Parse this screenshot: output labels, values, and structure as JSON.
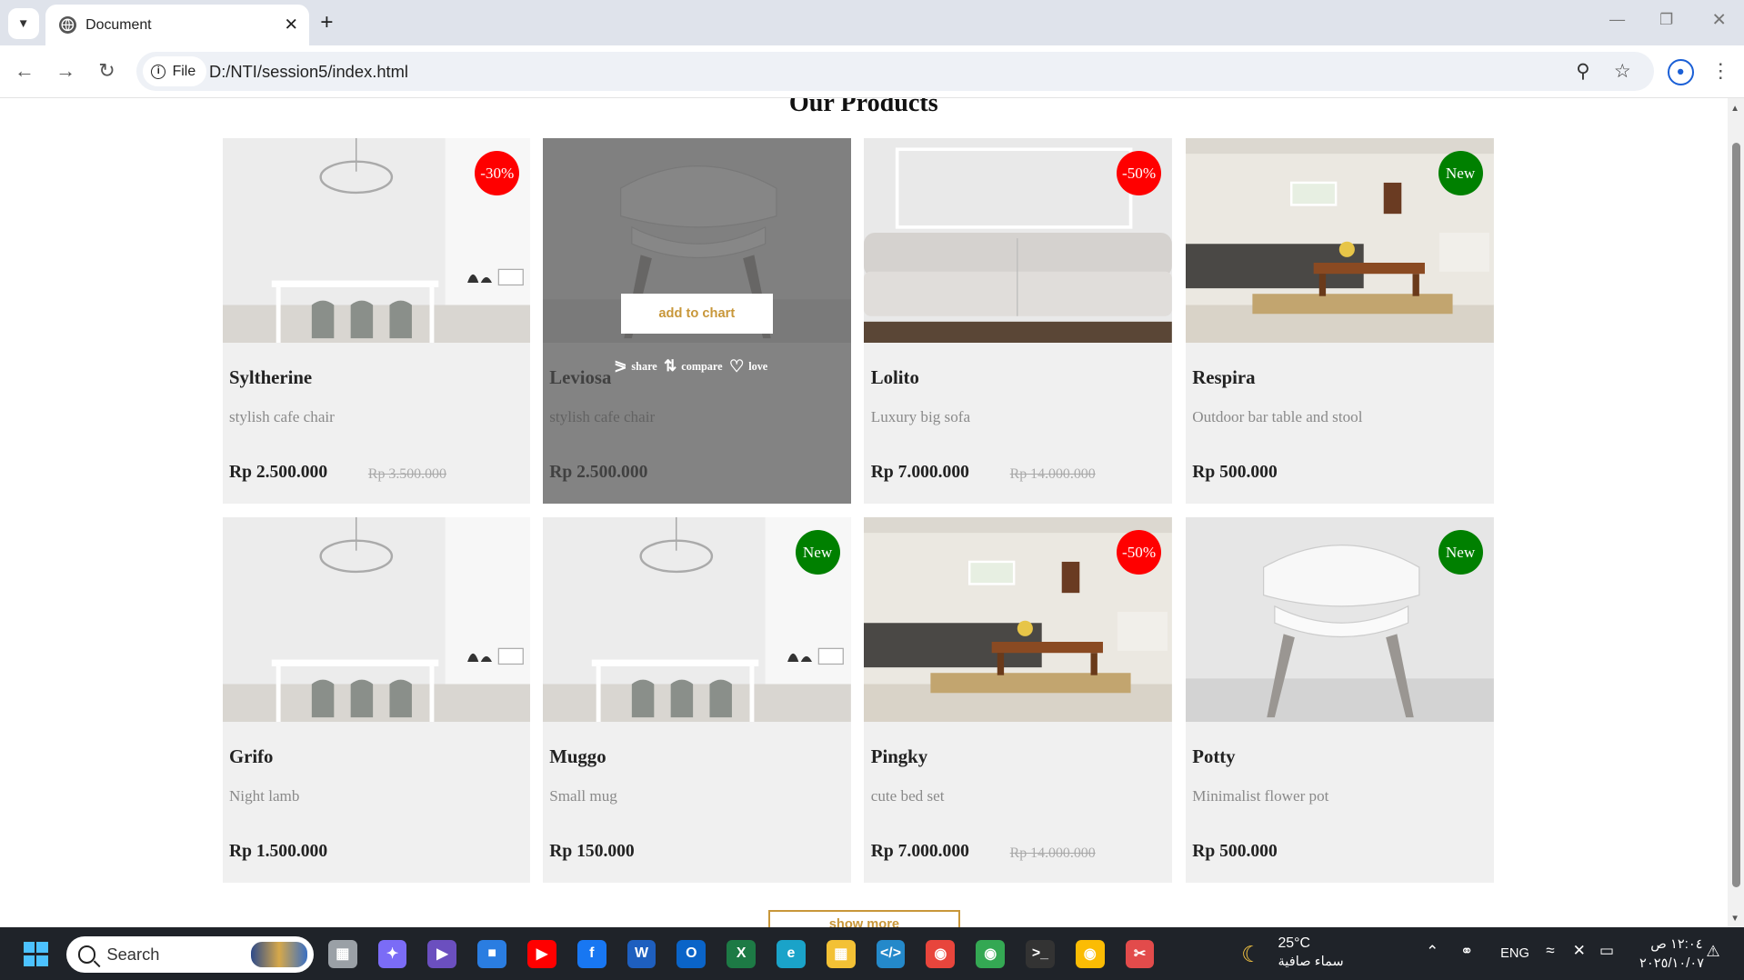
{
  "browser": {
    "tab_title": "Document",
    "url_scheme": "File",
    "url": "D:/NTI/session5/index.html"
  },
  "page": {
    "heading": "Our Products",
    "show_more": "show more",
    "hover": {
      "add_to_cart": "add to chart",
      "share": "share",
      "compare": "compare",
      "love": "love"
    },
    "products": [
      {
        "name": "Syltherine",
        "desc": "stylish cafe chair",
        "price": "Rp 2.500.000",
        "old_price": "Rp 3.500.000",
        "badge": "-30%",
        "badge_color": "#ff0000",
        "image": "dining-room"
      },
      {
        "name": "Leviosa",
        "desc": "stylish cafe chair",
        "price": "Rp 2.500.000",
        "old_price": "",
        "badge": "",
        "badge_color": "",
        "image": "white-chair",
        "hovered": true
      },
      {
        "name": "Lolito",
        "desc": "Luxury big sofa",
        "price": "Rp 7.000.000",
        "old_price": "Rp 14.000.000",
        "badge": "-50%",
        "badge_color": "#ff0000",
        "image": "white-sofa"
      },
      {
        "name": "Respira",
        "desc": "Outdoor bar table and stool",
        "price": "Rp 500.000",
        "old_price": "",
        "badge": "New",
        "badge_color": "#008000",
        "image": "living-room"
      },
      {
        "name": "Grifo",
        "desc": "Night lamb",
        "price": "Rp 1.500.000",
        "old_price": "",
        "badge": "",
        "badge_color": "",
        "image": "dining-room"
      },
      {
        "name": "Muggo",
        "desc": "Small mug",
        "price": "Rp 150.000",
        "old_price": "",
        "badge": "New",
        "badge_color": "#008000",
        "image": "dining-room"
      },
      {
        "name": "Pingky",
        "desc": "cute bed set",
        "price": "Rp 7.000.000",
        "old_price": "Rp 14.000.000",
        "badge": "-50%",
        "badge_color": "#ff0000",
        "image": "living-room"
      },
      {
        "name": "Potty",
        "desc": "Minimalist flower pot",
        "price": "Rp 500.000",
        "old_price": "",
        "badge": "New",
        "badge_color": "#008000",
        "image": "white-chair"
      }
    ]
  },
  "taskbar": {
    "search_placeholder": "Search",
    "weather_temp": "25°C",
    "weather_desc": "سماء صافية",
    "language": "ENG",
    "time": "١٢:٠٤ ص",
    "date": "٢٠٢٥/١٠/٠٧",
    "apps": [
      {
        "icon": "task-view-icon",
        "color": "#9aa0a6"
      },
      {
        "icon": "copilot-icon",
        "color": "#7b6cf6"
      },
      {
        "icon": "media-player-icon",
        "color": "#6b4fbf"
      },
      {
        "icon": "store-icon",
        "color": "#2a7de1"
      },
      {
        "icon": "youtube-icon",
        "color": "#ff0000"
      },
      {
        "icon": "facebook-icon",
        "color": "#1877f2"
      },
      {
        "icon": "word-icon",
        "color": "#1e5fbf"
      },
      {
        "icon": "outlook-icon",
        "color": "#0a64c8"
      },
      {
        "icon": "excel-icon",
        "color": "#1d7a45"
      },
      {
        "icon": "edge-icon",
        "color": "#1aa3c9"
      },
      {
        "icon": "file-explorer-icon",
        "color": "#f3c135"
      },
      {
        "icon": "vscode-icon",
        "color": "#2489ca"
      },
      {
        "icon": "chrome-profile-mo-icon",
        "color": "#e8453c"
      },
      {
        "icon": "chrome-profile-i-icon",
        "color": "#34a853"
      },
      {
        "icon": "terminal-icon",
        "color": "#333333"
      },
      {
        "icon": "chrome-icon",
        "color": "#fbbc04"
      },
      {
        "icon": "snipping-tool-icon",
        "color": "#e24b4b"
      }
    ]
  }
}
